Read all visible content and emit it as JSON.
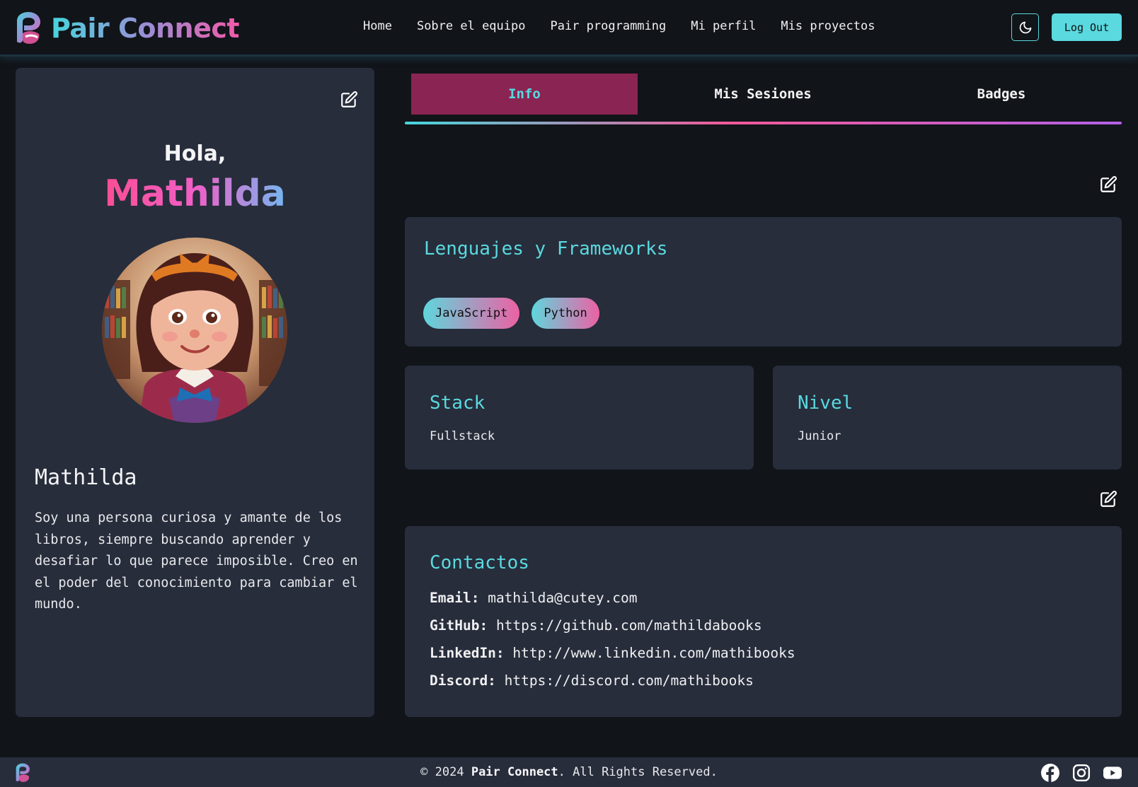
{
  "brand": {
    "name": "Pair Connect"
  },
  "nav": {
    "links": [
      "Home",
      "Sobre el equipo",
      "Pair programming",
      "Mi perfil",
      "Mis proyectos"
    ],
    "theme_icon": "moon-icon",
    "logout_label": "Log Out"
  },
  "profile": {
    "greeting": "Hola,",
    "greeting_name": "Mathilda",
    "name": "Mathilda",
    "bio": "Soy una persona curiosa y amante de los libros, siempre buscando aprender y desafiar lo que parece imposible. Creo en el poder del conocimiento para cambiar el mundo.",
    "edit_icon": "edit-icon"
  },
  "tabs": [
    {
      "label": "Info",
      "active": true
    },
    {
      "label": "Mis Sesiones",
      "active": false
    },
    {
      "label": "Badges",
      "active": false
    }
  ],
  "languages": {
    "title": "Lenguajes y Frameworks",
    "chips": [
      "JavaScript",
      "Python"
    ]
  },
  "stack": {
    "title": "Stack",
    "value": "Fullstack"
  },
  "level": {
    "title": "Nivel",
    "value": "Junior"
  },
  "contacts": {
    "title": "Contactos",
    "items": [
      {
        "label": "Email:",
        "value": "mathilda@cutey.com"
      },
      {
        "label": "GitHub:",
        "value": "https://github.com/mathildabooks"
      },
      {
        "label": "LinkedIn:",
        "value": "http://www.linkedin.com/mathibooks"
      },
      {
        "label": "Discord:",
        "value": "https://discord.com/mathibooks"
      }
    ]
  },
  "footer": {
    "prefix": "© 2024 ",
    "brand": "Pair Connect",
    "suffix": ". All Rights Reserved.",
    "social_icons": [
      "facebook-icon",
      "instagram-icon",
      "youtube-icon"
    ]
  },
  "colors": {
    "accent": "#5ad9df",
    "active_tab": "#8a2453",
    "card": "#272d3b",
    "background": "#111419"
  }
}
